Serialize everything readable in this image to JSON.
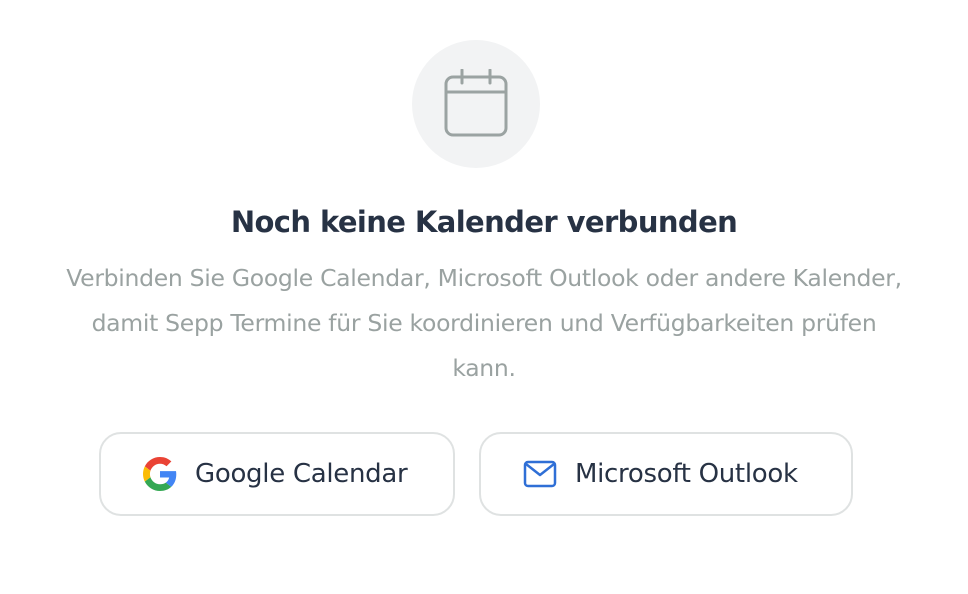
{
  "empty_state": {
    "icon": "calendar-icon",
    "title": "Noch keine Kalender verbunden",
    "description": "Verbinden Sie Google Calendar, Microsoft Outlook oder andere Kalender, damit Sepp Termine für Sie koordinieren und Verfügbarkeiten prüfen kann."
  },
  "buttons": {
    "google": {
      "label": "Google Calendar",
      "icon": "google-logo-icon"
    },
    "outlook": {
      "label": "Microsoft Outlook",
      "icon": "mail-icon"
    }
  },
  "colors": {
    "title": "#273244",
    "description": "#9aa2a1",
    "icon_circle_bg": "#f2f3f4",
    "icon_stroke": "#9ba3a2",
    "button_border": "#dfe2e2",
    "outlook_blue": "#2f6fd6",
    "google_blue": "#4285F4",
    "google_red": "#EA4335",
    "google_yellow": "#FBBC05",
    "google_green": "#34A853"
  }
}
